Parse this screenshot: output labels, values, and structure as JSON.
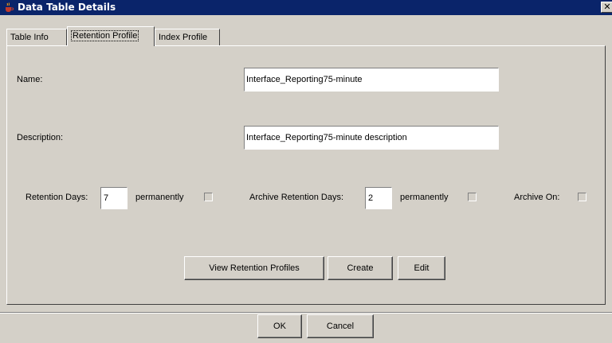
{
  "window": {
    "title": "Data Table Details",
    "close_label": "✕",
    "titlebar_color": "#0a246a",
    "app_icon": "coffee-cup-icon"
  },
  "tabs": [
    {
      "label": "Table Info",
      "active": false
    },
    {
      "label": "Retention Profile",
      "active": true
    },
    {
      "label": "Index Profile",
      "active": false
    }
  ],
  "form": {
    "name_label": "Name:",
    "name_value": "Interface_Reporting75-minute",
    "description_label": "Description:",
    "description_value": "Interface_Reporting75-minute description",
    "retention_days_label": "Retention Days:",
    "retention_days_value": "7",
    "permanently_label_1": "permanently",
    "permanently_checked_1": false,
    "archive_retention_days_label": "Archive Retention Days:",
    "archive_retention_days_value": "2",
    "permanently_label_2": "permanently",
    "permanently_checked_2": false,
    "archive_on_label": "Archive On:",
    "archive_on_checked": false
  },
  "actions": {
    "view_retention_profiles": "View Retention Profiles",
    "create": "Create",
    "edit": "Edit"
  },
  "footer": {
    "ok": "OK",
    "cancel": "Cancel"
  }
}
